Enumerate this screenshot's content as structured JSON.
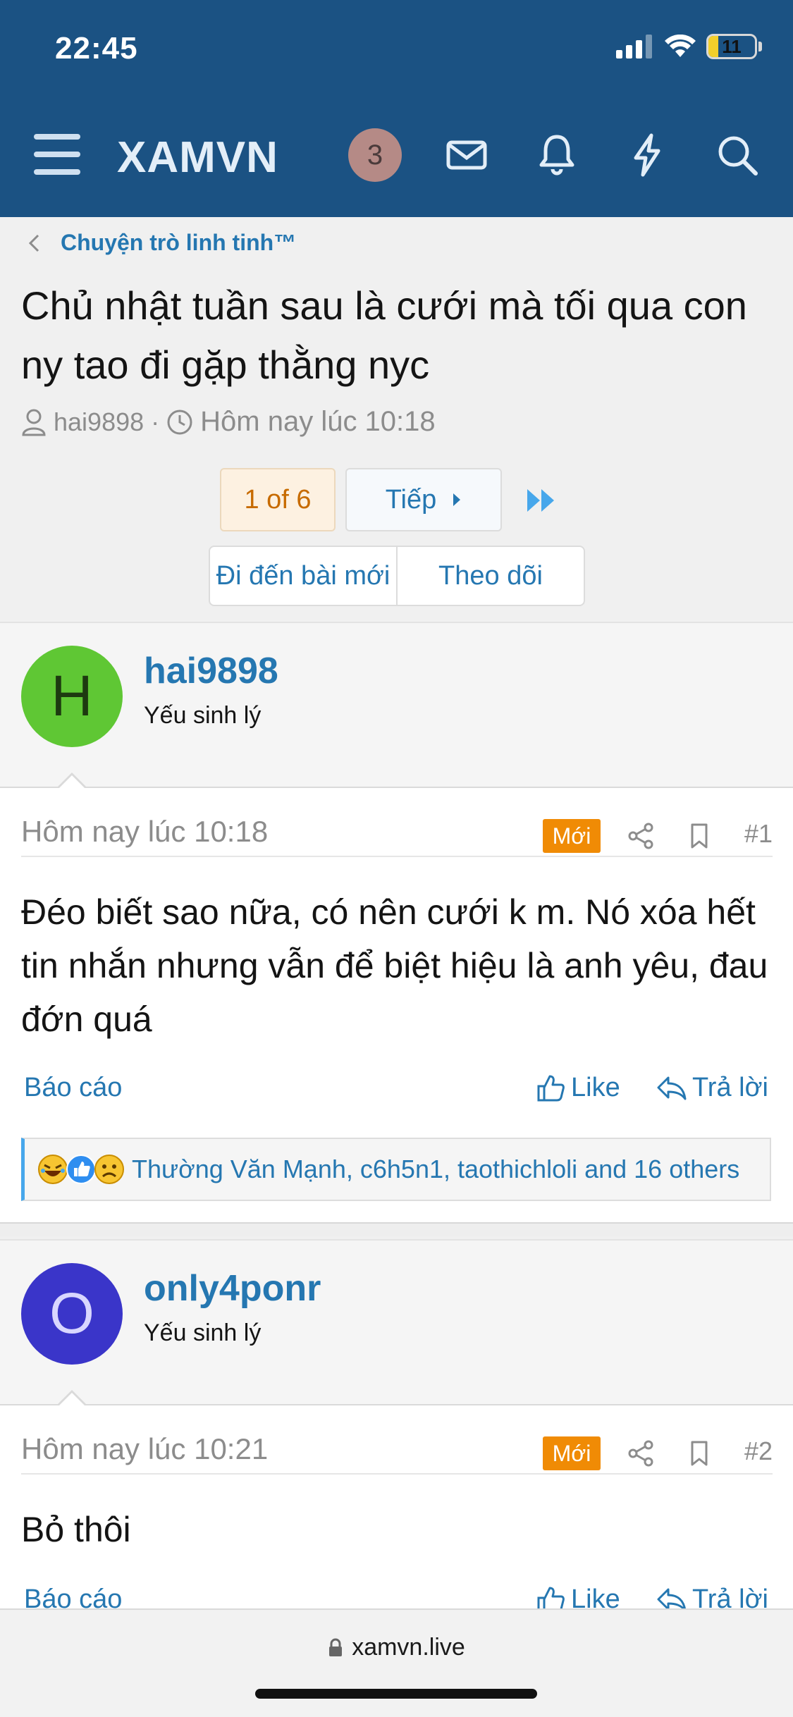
{
  "status_bar": {
    "time": "22:45",
    "battery": "11"
  },
  "nav": {
    "logo": "XAMVN",
    "notification_count": "3"
  },
  "breadcrumb": "Chuyện trò linh tinh™",
  "thread": {
    "title": "Chủ nhật tuần sau là cưới mà tối qua con ny tao đi gặp thằng nyc",
    "author": "hai9898",
    "time": "Hôm nay lúc 10:18"
  },
  "pagination": {
    "current": "1 of 6",
    "next": "Tiếp"
  },
  "actions": {
    "new_posts": "Đi đến bài mới",
    "watch": "Theo dõi"
  },
  "posts": [
    {
      "avatar_letter": "H",
      "avatar_color": "#5fc734",
      "username": "hai9898",
      "user_title": "Yếu sinh lý",
      "time": "Hôm nay lúc 10:18",
      "badge": "Mới",
      "number": "#1",
      "text": "Đéo biết sao nữa, có nên cưới k m. Nó xóa hết tin nhắn nhưng vẫn để biệt hiệu là anh yêu, đau đớn quá",
      "report": "Báo cáo",
      "like": "Like",
      "reply": "Trả lời",
      "reactions": "Thường Văn Mạnh, c6h5n1, taothichloli and 16 others"
    },
    {
      "avatar_letter": "O",
      "avatar_color": "#3a35c9",
      "username": "only4ponr",
      "user_title": "Yếu sinh lý",
      "time": "Hôm nay lúc 10:21",
      "badge": "Mới",
      "number": "#2",
      "text": "Bỏ thôi",
      "report": "Báo cáo",
      "like": "Like",
      "reply": "Trả lời"
    }
  ],
  "browser": {
    "url": "xamvn.live"
  }
}
